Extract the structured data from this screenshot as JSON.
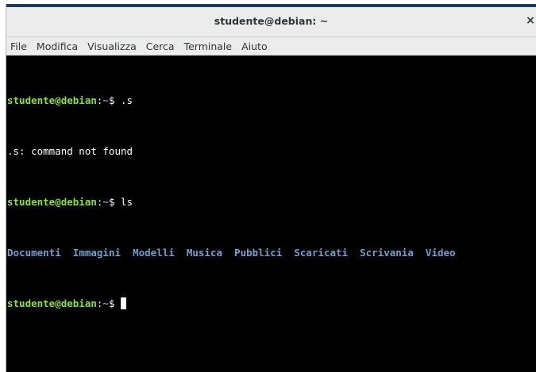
{
  "window": {
    "title": "studente@debian: ~",
    "close_glyph": "×"
  },
  "menu": {
    "items": [
      "File",
      "Modifica",
      "Visualizza",
      "Cerca",
      "Terminale",
      "Aiuto"
    ]
  },
  "terminal": {
    "prompt_user": "studente@debian",
    "prompt_sep": ":",
    "prompt_path": "~",
    "prompt_symbol": "$ ",
    "lines": [
      {
        "type": "prompt",
        "command": ".s"
      },
      {
        "type": "output",
        "text": ".s: command not found"
      },
      {
        "type": "prompt",
        "command": "ls"
      },
      {
        "type": "ls",
        "items": [
          "Documenti",
          "Immagini",
          "Modelli",
          "Musica",
          "Pubblici",
          "Scaricati",
          "Scrivania",
          "Video"
        ]
      },
      {
        "type": "prompt_active",
        "command": ""
      }
    ],
    "colors": {
      "background": "#000000",
      "prompt_user": "#8ae234",
      "prompt_path": "#729fcf",
      "directory": "#729fcf",
      "text": "#ffffff"
    }
  }
}
